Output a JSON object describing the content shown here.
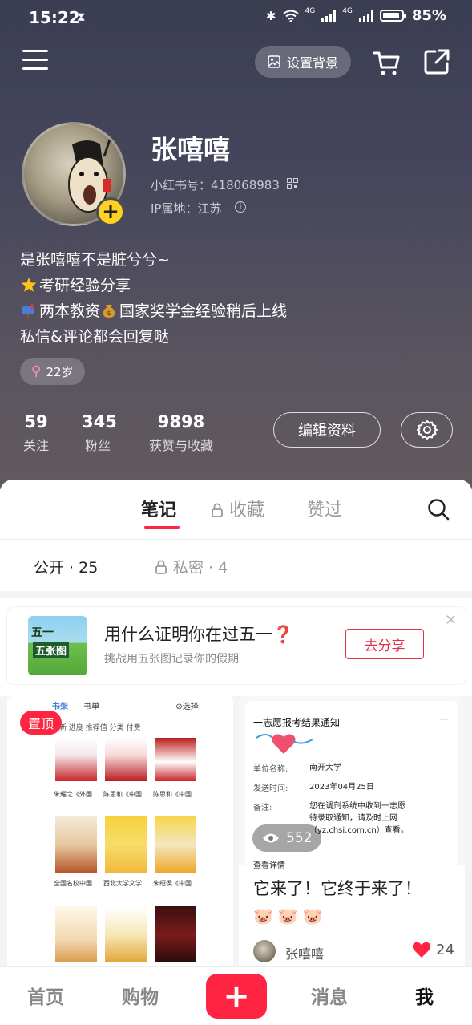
{
  "status_bar": {
    "time": "15:22",
    "battery": "85%",
    "network_a": "4G",
    "network_b": "4G"
  },
  "header": {
    "set_background_label": "设置背景"
  },
  "profile": {
    "name": "张嘻嘻",
    "user_id": "小红书号：418068983",
    "ip": "IP属地：江苏",
    "bio": [
      "是张嘻嘻不是脏兮兮~",
      "考研经验分享",
      "两本教资",
      "国家奖学金经验稍后上线",
      "私信&评论都会回复哒"
    ],
    "age_tag": "22岁",
    "stats": [
      {
        "value": "59",
        "label": "关注"
      },
      {
        "value": "345",
        "label": "粉丝"
      },
      {
        "value": "9898",
        "label": "获赞与收藏"
      }
    ],
    "edit_label": "编辑资料"
  },
  "tabs": {
    "notes": "笔记",
    "collect": "收藏",
    "liked": "赞过"
  },
  "subtabs": {
    "public": "公开 · 25",
    "private": "私密 · 4"
  },
  "banner": {
    "image_text_1": "五一",
    "image_text_2": "五张图",
    "title": "用什么证明你在过五一❓",
    "subtitle": "挑战用五张图记录你的假期",
    "button": "去分享"
  },
  "card1": {
    "pin_label": "置顶",
    "shot_tab_1": "书架",
    "shot_tab_2": "书单",
    "shot_select": "⊘选择",
    "shot_sub": "更新   进度   推荐值   分类   付费",
    "book_captions": [
      "朱耀之《外国...",
      "陈思和《中国...",
      "陈思和《中国...",
      "全国名校中国...",
      "西北大学文学...",
      "朱绍侯《中国..."
    ]
  },
  "card2": {
    "notice_title": "一志愿报考结果通知",
    "notice_more": "···",
    "label_school": "单位名称:",
    "value_school": "南开大学",
    "label_time": "发送时间:",
    "value_time": "2023年04月25日",
    "label_note": "备注:",
    "value_note_1": "您在调剂系统中收到一志愿",
    "value_note_2": "待录取通知，请及时上网",
    "value_note_3": "（yz.chsi.com.cn）查看。",
    "view_detail": "查看详情",
    "views": "552",
    "title": "它来了！它终于来了！",
    "emojis": "🐷🐷🐷",
    "author": "张嘻嘻",
    "likes": "24"
  },
  "bottom_nav": {
    "home": "首页",
    "shop": "购物",
    "add": "+",
    "messages": "消息",
    "me": "我"
  },
  "colors": {
    "accent": "#ff2442",
    "banner_button": "#e0314b",
    "avatar_badge": "#ffd21f"
  }
}
